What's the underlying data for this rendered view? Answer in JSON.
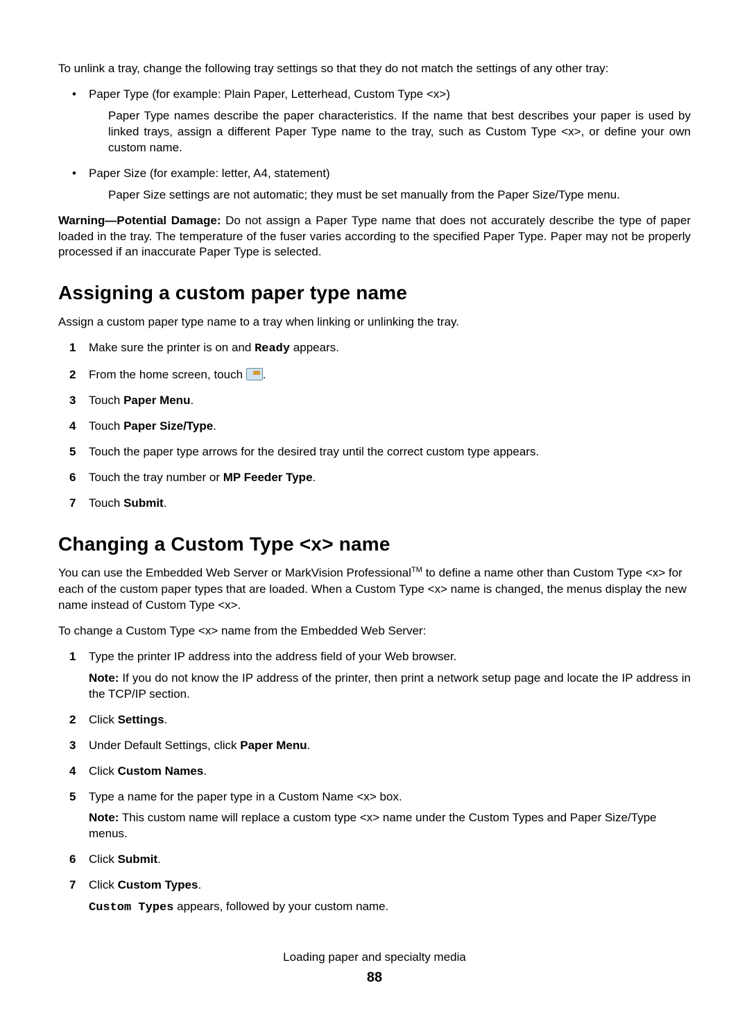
{
  "intro_p": "To unlink a tray, change the following tray settings so that they do not match the settings of any other tray:",
  "bullets": [
    {
      "text": "Paper Type (for example: Plain Paper, Letterhead, Custom Type <x>)",
      "sub": "Paper Type names describe the paper characteristics. If the name that best describes your paper is used by linked trays, assign a different Paper Type name to the tray, such as Custom Type <x>, or define your own custom name."
    },
    {
      "text": "Paper Size (for example: letter, A4, statement)",
      "sub": "Paper Size settings are not automatic; they must be set manually from the Paper Size/Type menu."
    }
  ],
  "warning_label": "Warning—Potential Damage:",
  "warning_body": " Do not assign a Paper Type name that does not accurately describe the type of paper loaded in the tray. The temperature of the fuser varies according to the specified Paper Type. Paper may not be properly processed if an inaccurate Paper Type is selected.",
  "sec1_title": "Assigning a custom paper type name",
  "sec1_intro": "Assign a custom paper type name to a tray when linking or unlinking the tray.",
  "sec1_steps": {
    "s1a": "Make sure the printer is on and ",
    "s1b": "Ready",
    "s1c": " appears.",
    "s2a": "From the home screen, touch ",
    "s2b": ".",
    "s3a": "Touch ",
    "s3b": "Paper Menu",
    "s3c": ".",
    "s4a": "Touch ",
    "s4b": "Paper Size/Type",
    "s4c": ".",
    "s5": "Touch the paper type arrows for the desired tray until the correct custom type appears.",
    "s6a": "Touch the tray number or ",
    "s6b": "MP Feeder Type",
    "s6c": ".",
    "s7a": "Touch ",
    "s7b": "Submit",
    "s7c": "."
  },
  "sec2_title": "Changing a Custom Type <x> name",
  "sec2_p1a": "You can use the Embedded Web Server or MarkVision Professional",
  "sec2_p1_sup": "TM",
  "sec2_p1b": " to define a name other than Custom Type <x> for each of the custom paper types that are loaded. When a Custom Type <x> name is changed, the menus display the new name instead of Custom Type <x>.",
  "sec2_p2": "To change a Custom Type <x> name from the Embedded Web Server:",
  "sec2_steps": {
    "s1": "Type the printer IP address into the address field of your Web browser.",
    "s1_note_label": "Note:",
    "s1_note_body": " If you do not know the IP address of the printer, then print a network setup page and locate the IP address in the TCP/IP section.",
    "s2a": "Click ",
    "s2b": "Settings",
    "s2c": ".",
    "s3a": "Under Default Settings, click ",
    "s3b": "Paper Menu",
    "s3c": ".",
    "s4a": "Click ",
    "s4b": "Custom Names",
    "s4c": ".",
    "s5": "Type a name for the paper type in a Custom Name <x> box.",
    "s5_note_label": "Note:",
    "s5_note_body": " This custom name will replace a custom type <x> name under the Custom Types and Paper Size/Type menus.",
    "s6a": "Click ",
    "s6b": "Submit",
    "s6c": ".",
    "s7a": "Click ",
    "s7b": "Custom Types",
    "s7c": ".",
    "s7_follow_mono": "Custom Types",
    "s7_follow_rest": " appears, followed by your custom name."
  },
  "footer_title": "Loading paper and specialty media",
  "footer_page": "88"
}
